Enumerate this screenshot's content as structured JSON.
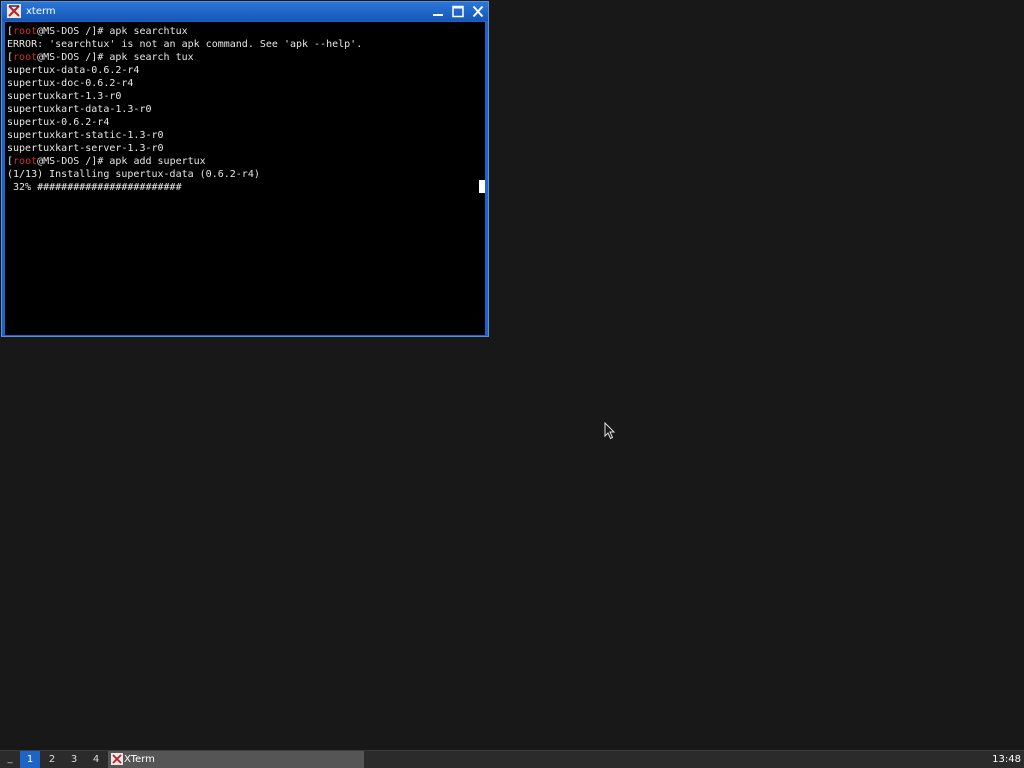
{
  "window": {
    "title": "xterm",
    "icon": "xterm-icon",
    "buttons": {
      "minimize": "minimize-icon",
      "maximize": "maximize-icon",
      "close": "close-icon"
    }
  },
  "terminal": {
    "prompt_user": "root",
    "prompt_host": "@MS-DOS /]# ",
    "lines": [
      {
        "type": "prompt",
        "command": "apk searchtux"
      },
      {
        "type": "output",
        "text": "ERROR: 'searchtux' is not an apk command. See 'apk --help'."
      },
      {
        "type": "prompt",
        "command": "apk search tux"
      },
      {
        "type": "output",
        "text": "supertux-data-0.6.2-r4"
      },
      {
        "type": "output",
        "text": "supertux-doc-0.6.2-r4"
      },
      {
        "type": "output",
        "text": "supertuxkart-1.3-r0"
      },
      {
        "type": "output",
        "text": "supertuxkart-data-1.3-r0"
      },
      {
        "type": "output",
        "text": "supertux-0.6.2-r4"
      },
      {
        "type": "output",
        "text": "supertuxkart-static-1.3-r0"
      },
      {
        "type": "output",
        "text": "supertuxkart-server-1.3-r0"
      },
      {
        "type": "prompt",
        "command": "apk add supertux"
      },
      {
        "type": "output",
        "text": "(1/13) Installing supertux-data (0.6.2-r4)"
      },
      {
        "type": "output",
        "text": " 32% ########################"
      }
    ],
    "colors": {
      "background": "#000000",
      "foreground": "#e6e6e6",
      "prompt_user": "#d03030"
    }
  },
  "taskbar": {
    "menu_label": "_",
    "workspaces": [
      "1",
      "2",
      "3",
      "4"
    ],
    "active_workspace": "1",
    "tasks": [
      {
        "label": "XTerm",
        "icon": "xterm-icon"
      }
    ],
    "clock": "13:48"
  },
  "colors": {
    "accent": "#1d64c8",
    "desktop": "#181818",
    "taskbar": "#2b2b2b"
  }
}
